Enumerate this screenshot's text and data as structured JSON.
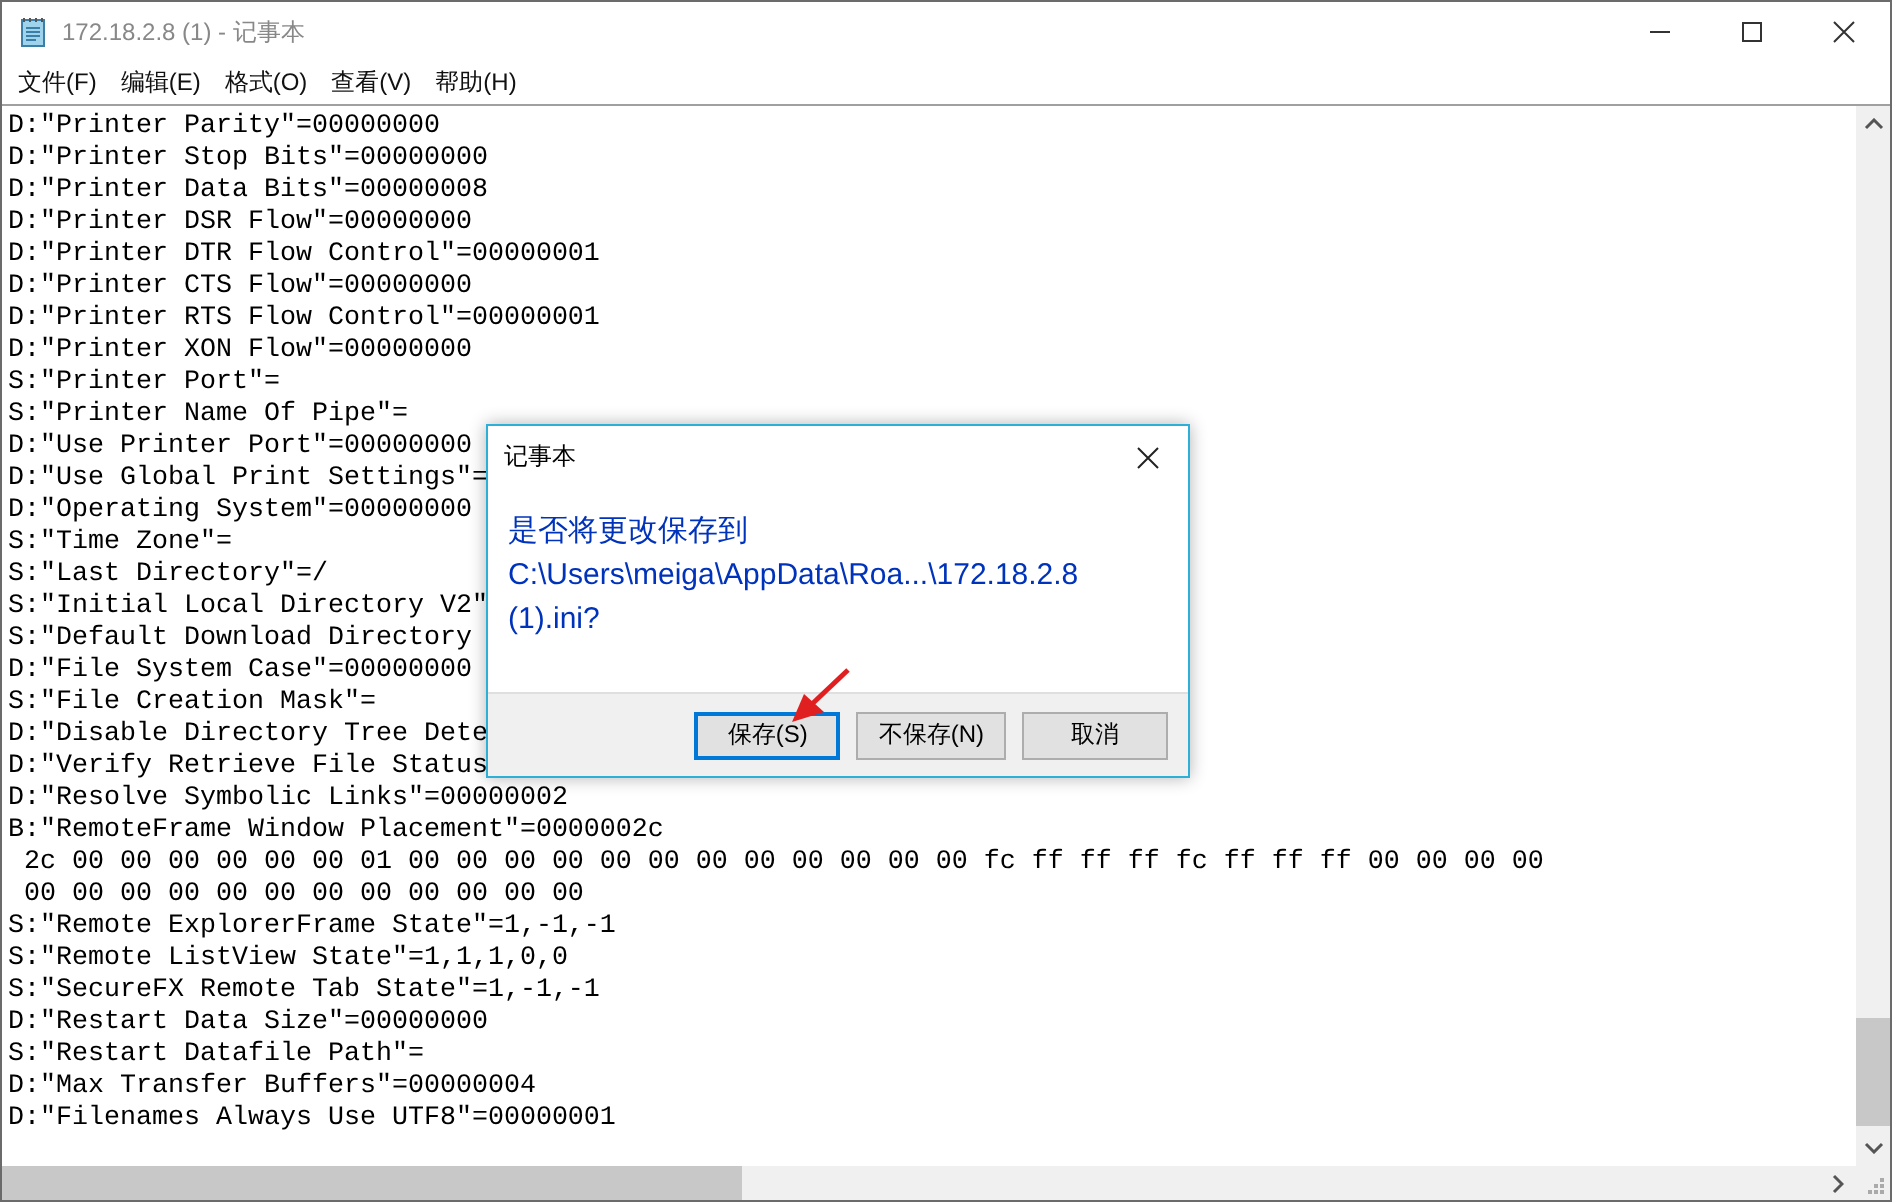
{
  "window": {
    "title": "172.18.2.8 (1) - 记事本"
  },
  "menu": [
    "文件(F)",
    "编辑(E)",
    "格式(O)",
    "查看(V)",
    "帮助(H)"
  ],
  "lines": [
    "D:\"Printer Parity\"=00000000",
    "D:\"Printer Stop Bits\"=00000000",
    "D:\"Printer Data Bits\"=00000008",
    "D:\"Printer DSR Flow\"=00000000",
    "D:\"Printer DTR Flow Control\"=00000001",
    "D:\"Printer CTS Flow\"=00000000",
    "D:\"Printer RTS Flow Control\"=00000001",
    "D:\"Printer XON Flow\"=00000000",
    "S:\"Printer Port\"=",
    "S:\"Printer Name Of Pipe\"=",
    "D:\"Use Printer Port\"=00000000",
    "D:\"Use Global Print Settings\"=",
    "D:\"Operating System\"=00000000",
    "S:\"Time Zone\"=",
    "S:\"Last Directory\"=/",
    "S:\"Initial Local Directory V2\"",
    "S:\"Default Download Directory",
    "D:\"File System Case\"=00000000",
    "S:\"File Creation Mask\"=",
    "D:\"Disable Directory Tree Dete",
    "D:\"Verify Retrieve File Status",
    "D:\"Resolve Symbolic Links\"=00000002",
    "B:\"RemoteFrame Window Placement\"=0000002c",
    " 2c 00 00 00 00 00 00 01 00 00 00 00 00 00 00 00 00 00 00 00 fc ff ff ff fc ff ff ff 00 00 00 00",
    " 00 00 00 00 00 00 00 00 00 00 00 00",
    "S:\"Remote ExplorerFrame State\"=1,-1,-1",
    "S:\"Remote ListView State\"=1,1,1,0,0",
    "S:\"SecureFX Remote Tab State\"=1,-1,-1",
    "D:\"Restart Data Size\"=00000000",
    "S:\"Restart Datafile Path\"=",
    "D:\"Max Transfer Buffers\"=00000004",
    "D:\"Filenames Always Use UTF8\"=00000001"
  ],
  "dialog": {
    "title": "记事本",
    "question": "是否将更改保存到",
    "path": "C:\\Users\\meiga\\AppData\\Roa...\\172.18.2.8 (1).ini?",
    "buttons": [
      {
        "label": "保存(S)",
        "default": true
      },
      {
        "label": "不保存(N)",
        "default": false
      },
      {
        "label": "取消",
        "default": false
      }
    ]
  }
}
